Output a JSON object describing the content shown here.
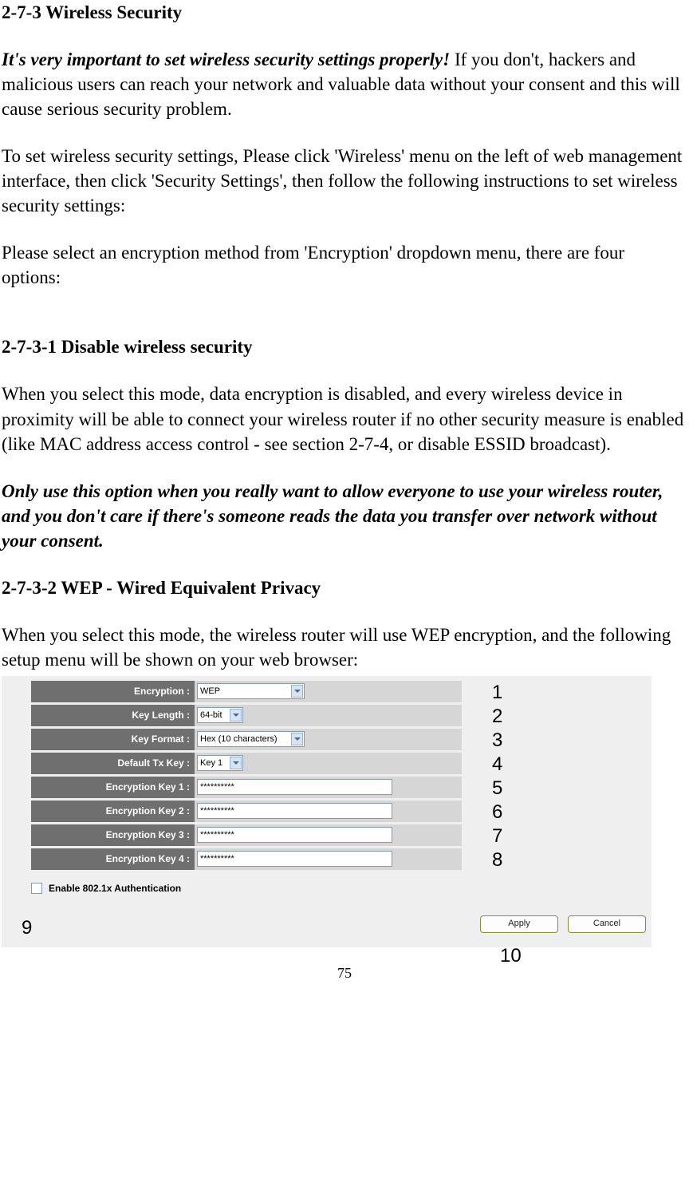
{
  "headings": {
    "h1": "2-7-3 Wireless Security",
    "h2a": "2-7-3-1 Disable wireless security",
    "h2b": "2-7-3-2 WEP - Wired Equivalent Privacy"
  },
  "paragraphs": {
    "p1_em": "It's very important to set wireless security settings properly!",
    "p1_rest": " If you don't, hackers and malicious users can reach your network and valuable data without your consent and this will cause serious security problem.",
    "p2": "To set wireless security settings, Please click 'Wireless' menu on the left of web management interface, then click 'Security Settings', then follow the following instructions to set wireless security settings:",
    "p3": "Please select an encryption method from 'Encryption' dropdown menu, there are four options:",
    "p4": "When you select this mode, data encryption is disabled, and every wireless device in proximity will be able to connect your wireless router if no other security measure is enabled (like MAC address access control - see section 2-7-4, or disable ESSID broadcast).",
    "p5": "Only use this option when you really want to allow everyone to use your wireless router, and you don't care if there's someone reads the data you transfer over network without your consent.",
    "p6": "When you select this mode, the wireless router will use WEP encryption, and the following setup menu will be shown on your web browser:"
  },
  "form": {
    "labels": {
      "encryption": "Encryption :",
      "keylen": "Key Length :",
      "keyfmt": "Key Format :",
      "txkey": "Default Tx Key :",
      "k1": "Encryption Key 1 :",
      "k2": "Encryption Key 2 :",
      "k3": "Encryption Key 3 :",
      "k4": "Encryption Key 4 :"
    },
    "values": {
      "encryption": "WEP",
      "keylen": "64-bit",
      "keyfmt": "Hex (10 characters)",
      "txkey": "Key 1",
      "k1": "**********",
      "k2": "**********",
      "k3": "**********",
      "k4": "**********"
    },
    "checkbox_label": "Enable 802.1x Authentication",
    "apply": "Apply",
    "cancel": "Cancel"
  },
  "annotations": {
    "a1": "1",
    "a2": "2",
    "a3": "3",
    "a4": "4",
    "a5": "5",
    "a6": "6",
    "a7": "7",
    "a8": "8",
    "a9": "9",
    "a10": "10"
  },
  "page_number": "75"
}
